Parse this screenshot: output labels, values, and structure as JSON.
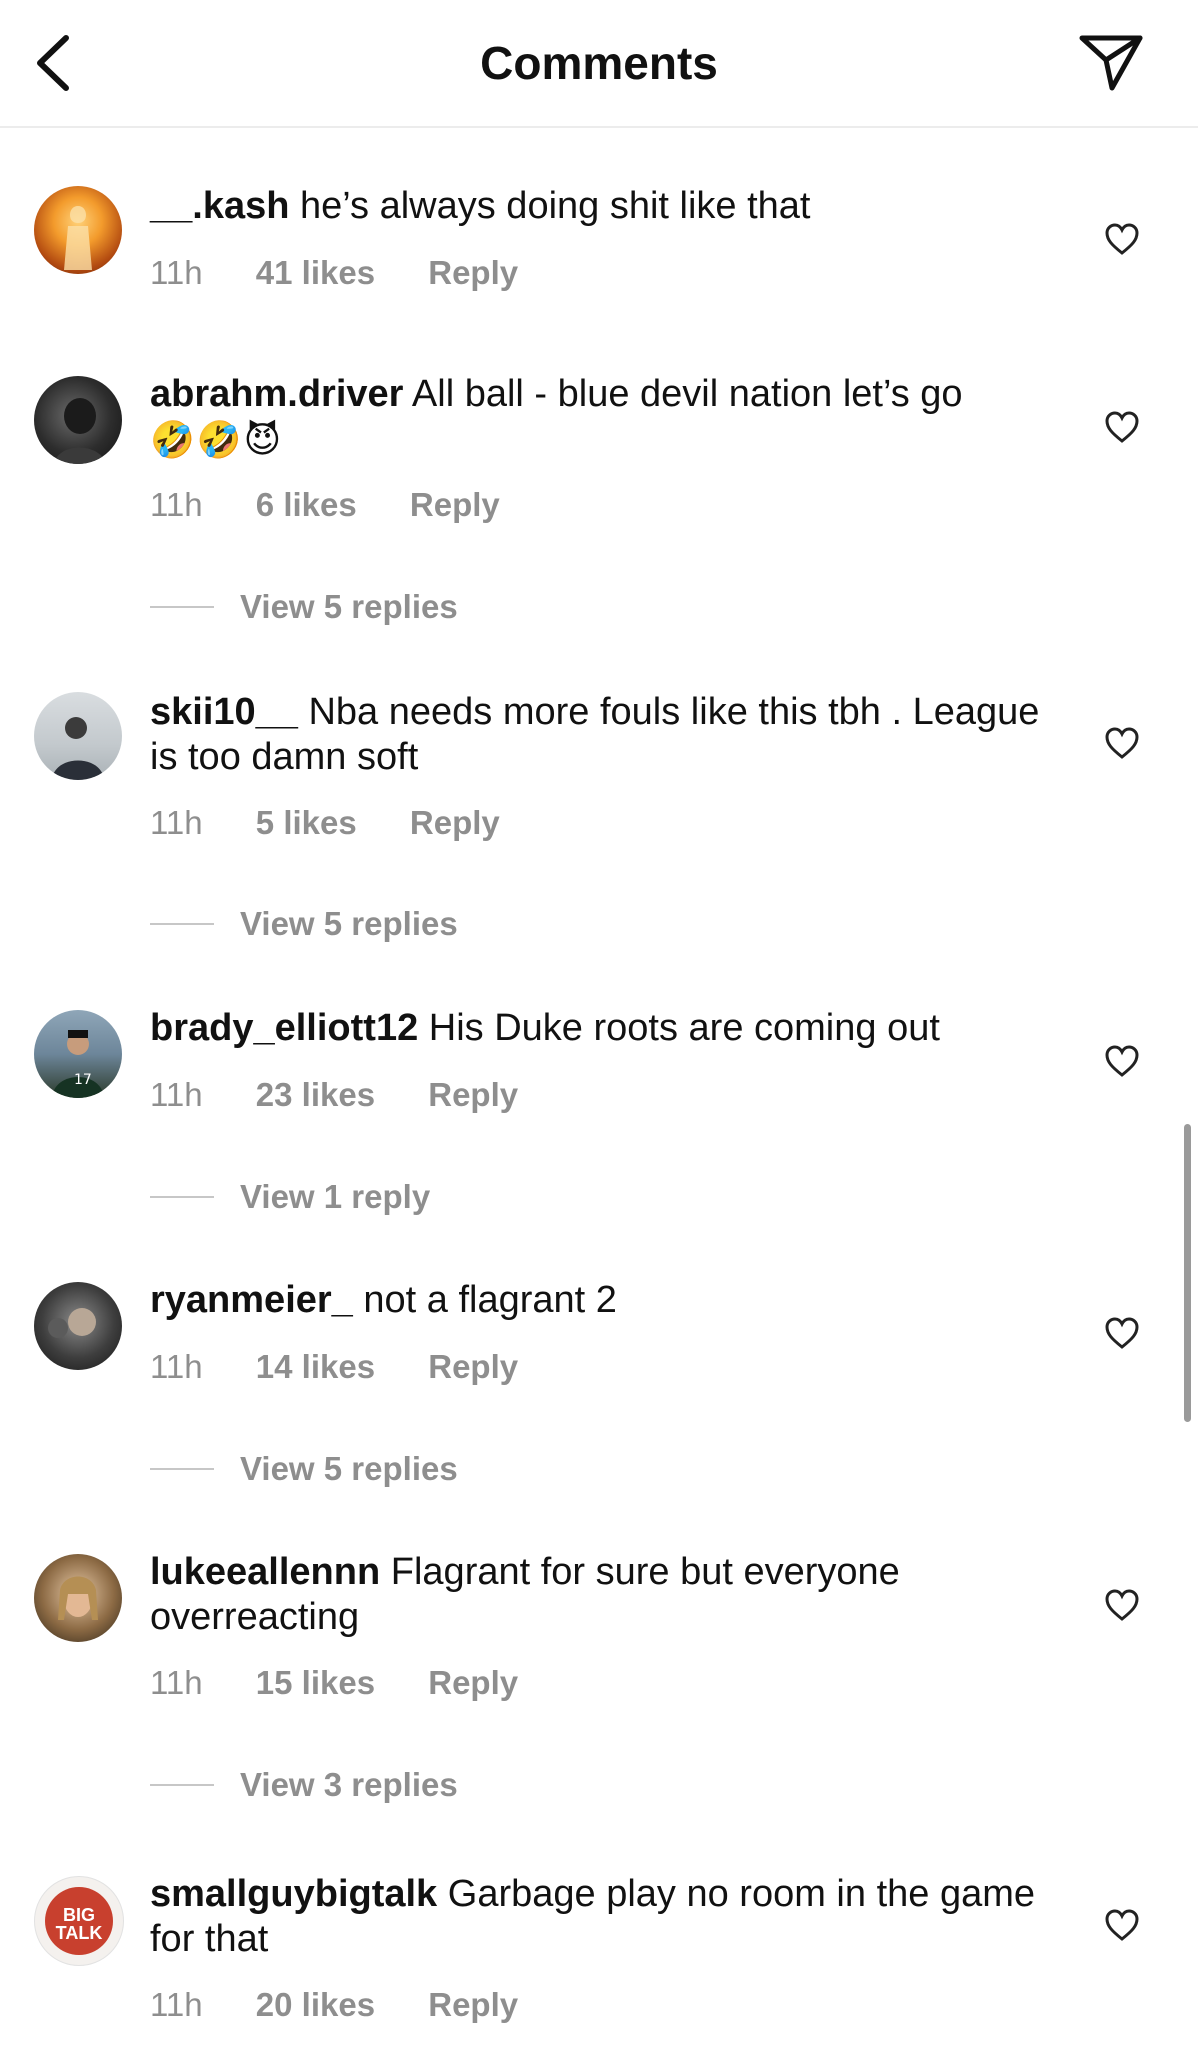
{
  "header": {
    "title": "Comments"
  },
  "comments": [
    {
      "username": "__.kash",
      "text": "he’s always doing shit like that",
      "emoji": "",
      "time": "11h",
      "likes": "41 likes",
      "reply": "Reply",
      "view_replies": ""
    },
    {
      "username": "abrahm.driver",
      "text": "All ball - blue devil nation let’s go",
      "emoji": "🤣🤣😈",
      "time": "11h",
      "likes": "6 likes",
      "reply": "Reply",
      "view_replies": "View 5 replies"
    },
    {
      "username": "skii10__",
      "text": "Nba needs more fouls like this tbh . League is too damn soft",
      "emoji": "",
      "time": "11h",
      "likes": "5 likes",
      "reply": "Reply",
      "view_replies": "View 5 replies"
    },
    {
      "username": "brady_elliott12",
      "text": "His Duke roots are coming out",
      "emoji": "",
      "time": "11h",
      "likes": "23 likes",
      "reply": "Reply",
      "view_replies": "View 1 reply"
    },
    {
      "username": "ryanmeier_",
      "text": "not a flagrant 2",
      "emoji": "",
      "time": "11h",
      "likes": "14 likes",
      "reply": "Reply",
      "view_replies": "View 5 replies"
    },
    {
      "username": "lukeeallennn",
      "text": "Flagrant for sure but everyone overreacting",
      "emoji": "",
      "time": "11h",
      "likes": "15 likes",
      "reply": "Reply",
      "view_replies": "View 3 replies"
    },
    {
      "username": "smallguybigtalk",
      "text": "Garbage play no room in the game for that",
      "emoji": "",
      "time": "11h",
      "likes": "20 likes",
      "reply": "Reply",
      "view_replies": ""
    }
  ],
  "avatars": {
    "smallguybigtalk_logo_text": "BIG TALK"
  },
  "colors": {
    "secondary_text": "#8e8e8e",
    "divider": "#ececec"
  }
}
